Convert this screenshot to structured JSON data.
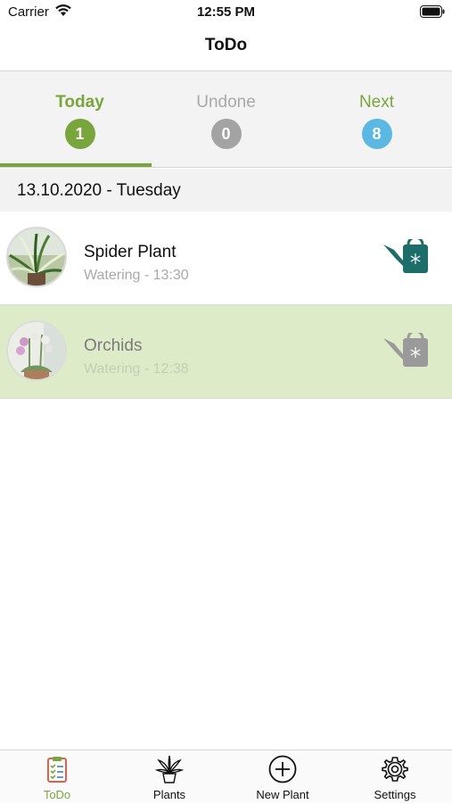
{
  "status_bar": {
    "carrier": "Carrier",
    "time": "12:55 PM"
  },
  "nav": {
    "title": "ToDo"
  },
  "segments": [
    {
      "label": "Today",
      "count": "1",
      "color": "#78a53c",
      "badge_color": "#78a53c",
      "selected": true
    },
    {
      "label": "Undone",
      "count": "0",
      "color": "#a8a8a8",
      "badge_color": "#a3a3a3",
      "selected": false
    },
    {
      "label": "Next",
      "count": "8",
      "color": "#78a53c",
      "badge_color": "#5bb8e3",
      "selected": false
    }
  ],
  "date_header": "13.10.2020 - Tuesday",
  "todos": [
    {
      "plant": "Spider Plant",
      "task": "Watering - 13:30",
      "done": false,
      "icon": "watering-can-icon",
      "icon_color": "#1d6e6a"
    },
    {
      "plant": "Orchids",
      "task": "Watering - 12:38",
      "done": true,
      "icon": "watering-can-icon",
      "icon_color": "#9a9a9a"
    }
  ],
  "tabs": [
    {
      "label": "ToDo",
      "icon": "clipboard-checklist-icon",
      "active": true,
      "color": "#78a53c"
    },
    {
      "label": "Plants",
      "icon": "potted-plant-icon",
      "active": false
    },
    {
      "label": "New Plant",
      "icon": "add-circle-icon",
      "active": false
    },
    {
      "label": "Settings",
      "icon": "gear-icon",
      "active": false
    }
  ]
}
